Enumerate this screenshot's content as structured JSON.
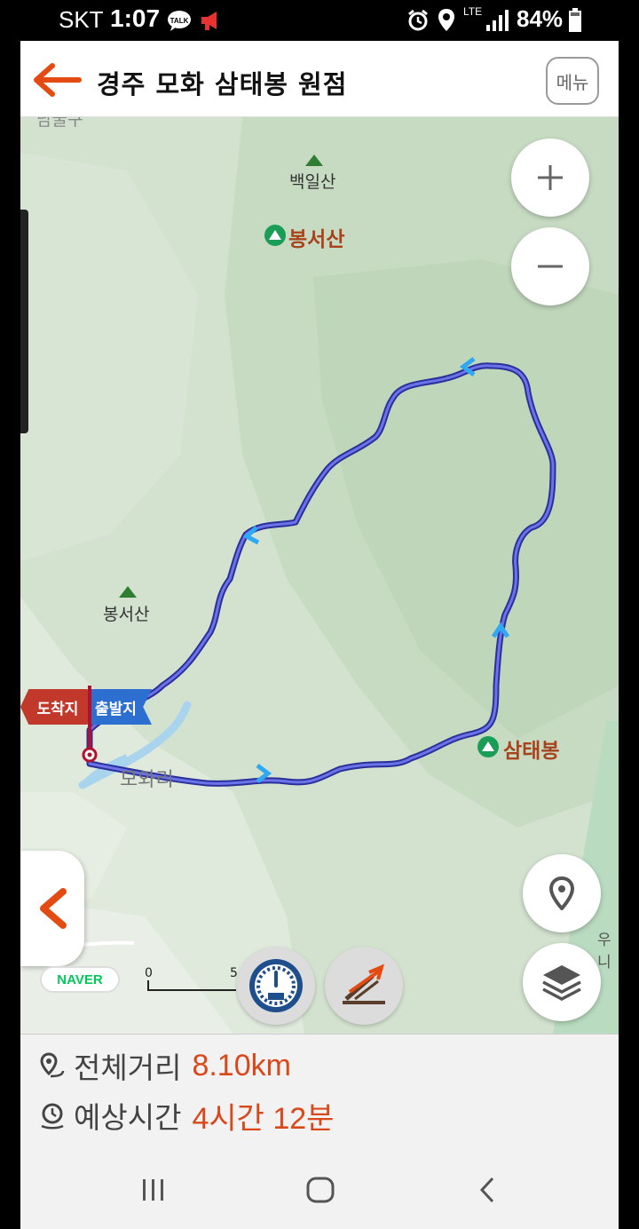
{
  "status_bar": {
    "carrier": "SKT",
    "time": "1:07",
    "network": "LTE",
    "battery": "84%"
  },
  "header": {
    "title": "경주 모화 삼태봉 원점",
    "menu_label": "메뉴"
  },
  "map": {
    "labels": {
      "baekilsan": "백일산",
      "bongseosan_peak": "봉서산",
      "bongseosan_small": "봉서산",
      "samtaebong": "삼태봉",
      "mohwari": "모와리",
      "edge_label": "우니",
      "top_clipped": "남굴구"
    },
    "markers": {
      "arrival": "도착지",
      "departure": "출발지"
    },
    "brand": "NAVER",
    "scale": {
      "start": "0",
      "end": "5"
    },
    "route_color": "#4a4fd0",
    "accent": "#d9481b"
  },
  "summary": {
    "distance_label": "전체거리",
    "distance_value": "8.10km",
    "time_label": "예상시간",
    "time_value": "4시간 12분"
  },
  "system_nav": {
    "recent_icon": "recent-apps-icon",
    "home_icon": "home-icon",
    "back_icon": "back-icon"
  }
}
